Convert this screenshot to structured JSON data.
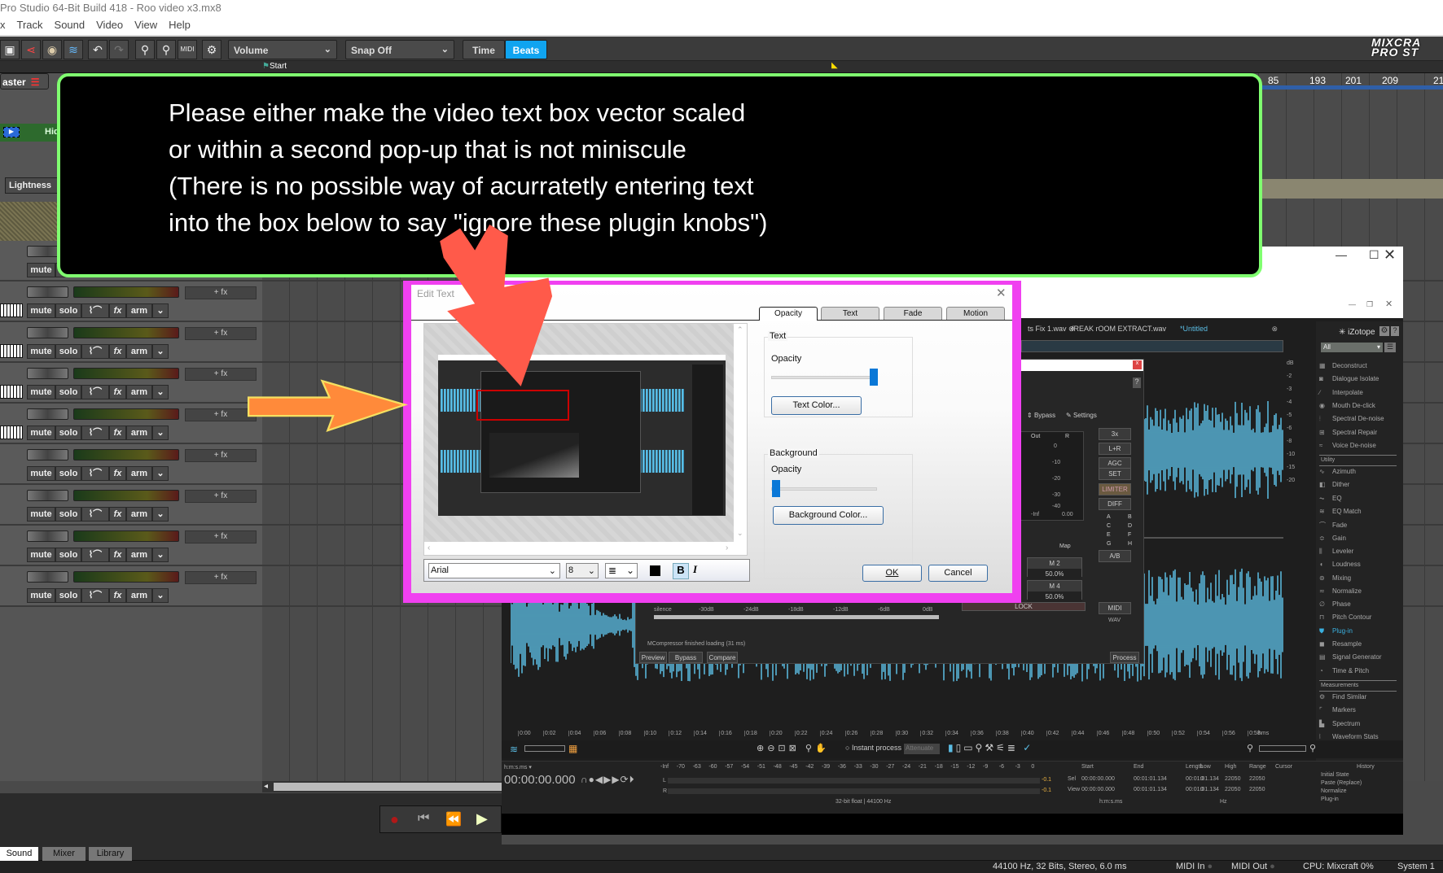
{
  "window": {
    "title": "Pro Studio 64-Bit Build 418 - Roo video x3.mx8"
  },
  "menu": [
    "x",
    "Track",
    "Sound",
    "Video",
    "View",
    "Help"
  ],
  "toolbar": {
    "icons": [
      "save-icon",
      "share-icon",
      "cd-burn-icon",
      "mixdown-icon",
      "undo-icon",
      "redo-icon",
      "zoom-in-icon",
      "zoom-out-icon",
      "midi-icon",
      "gear-icon"
    ],
    "automation_select": "Volume",
    "snap_select": "Snap Off",
    "time_label": "Time",
    "beats_label": "Beats",
    "logo_line1": "MIXCRA",
    "logo_line2": "PRO ST",
    "accent": "#10a4f0"
  },
  "timeline": {
    "start_marker": "Start",
    "bars": [
      "85",
      "193",
      "201",
      "209",
      "21"
    ]
  },
  "tracks": {
    "master": "aster",
    "video": "Hid",
    "lightness": "Lightness",
    "add_fx": "+ fx",
    "mute": "mute",
    "solo": "solo",
    "fx": "fx",
    "arm": "arm",
    "rows": [
      {
        "piano": false
      },
      {
        "piano": true
      },
      {
        "piano": true
      },
      {
        "piano": true
      },
      {
        "piano": true
      },
      {
        "piano": false
      },
      {
        "piano": false
      },
      {
        "piano": false
      },
      {
        "piano": false
      }
    ]
  },
  "annotation": {
    "lines": [
      "Please either make the video text box vector scaled",
      "or within a second pop-up that is not miniscule",
      "(There is no possible way of acurratetly entering text",
      "into the box below to say \"ignore these plugin knobs\")"
    ],
    "border_color": "#80ff70",
    "arrow_color": "#ff5a4a",
    "side_arrow_color": "#ff8a3a"
  },
  "edit_text": {
    "title": "Edit Text",
    "tabs": [
      "Opacity",
      "Text",
      "Fade",
      "Motion"
    ],
    "active_tab": "Opacity",
    "text_group": "Text",
    "opacity_label": "Opacity",
    "text_opacity": 100,
    "text_color_button": "Text Color...",
    "background_group": "Background",
    "background_opacity": 0,
    "background_color_button": "Background Color...",
    "font": "Arial",
    "size": "8",
    "bold": "B",
    "italic": "I",
    "ok": "OK",
    "cancel": "Cancel"
  },
  "izotope": {
    "file_tabs": [
      "ts Fix 1.wav",
      "fREAK rOOM EXTRACT.wav",
      "*Untitled"
    ],
    "brand": "iZotope",
    "filter": "All",
    "modules": [
      {
        "t": "item",
        "label": "Deconstruct"
      },
      {
        "t": "item",
        "label": "Dialogue Isolate"
      },
      {
        "t": "item",
        "label": "Interpolate"
      },
      {
        "t": "item",
        "label": "Mouth De-click"
      },
      {
        "t": "item",
        "label": "Spectral De-noise"
      },
      {
        "t": "item",
        "label": "Spectral Repair"
      },
      {
        "t": "item",
        "label": "Voice De-noise"
      },
      {
        "t": "head",
        "label": "Utility"
      },
      {
        "t": "item",
        "label": "Azimuth"
      },
      {
        "t": "item",
        "label": "Dither"
      },
      {
        "t": "item",
        "label": "EQ"
      },
      {
        "t": "item",
        "label": "EQ Match"
      },
      {
        "t": "item",
        "label": "Fade"
      },
      {
        "t": "item",
        "label": "Gain"
      },
      {
        "t": "item",
        "label": "Leveler"
      },
      {
        "t": "item",
        "label": "Loudness"
      },
      {
        "t": "item",
        "label": "Mixing"
      },
      {
        "t": "item",
        "label": "Normalize"
      },
      {
        "t": "item",
        "label": "Phase"
      },
      {
        "t": "item",
        "label": "Pitch Contour"
      },
      {
        "t": "item",
        "label": "Plug-in",
        "active": true
      },
      {
        "t": "item",
        "label": "Resample"
      },
      {
        "t": "item",
        "label": "Signal Generator"
      },
      {
        "t": "item",
        "label": "Time & Pitch"
      },
      {
        "t": "head",
        "label": "Measurements"
      },
      {
        "t": "item",
        "label": "Find Similar"
      },
      {
        "t": "item",
        "label": "Markers"
      },
      {
        "t": "item",
        "label": "Spectrum"
      },
      {
        "t": "item",
        "label": "Waveform Stats"
      }
    ],
    "db_scale": [
      "dB",
      "-2",
      "-3",
      "-4",
      "-5",
      "-6",
      "-8",
      "-10",
      "-15",
      "-20"
    ],
    "time_ruler": [
      "0:00",
      "0:02",
      "0:04",
      "0:06",
      "0:08",
      "0:10",
      "0:12",
      "0:14",
      "0:16",
      "0:18",
      "0:20",
      "0:22",
      "0:24",
      "0:26",
      "0:28",
      "0:30",
      "0:32",
      "0:34",
      "0:36",
      "0:38",
      "0:40",
      "0:42",
      "0:44",
      "0:46",
      "0:48",
      "0:50",
      "0:52",
      "0:54",
      "0:56",
      "0:58"
    ],
    "time_unit": "hms",
    "instant_process": "Instant process",
    "instant_mode": "Attenuate",
    "time_format": "h:m:s.ms ▾",
    "time": "00:00:00.000",
    "meter_scale": [
      "-Inf",
      "-70",
      "-63",
      "-60",
      "-57",
      "-54",
      "-51",
      "-48",
      "-45",
      "-42",
      "-39",
      "-36",
      "-33",
      "-30",
      "-27",
      "-24",
      "-21",
      "-18",
      "-15",
      "-12",
      "-9",
      "-6",
      "-3",
      "0"
    ],
    "meter_L": "L",
    "meter_R": "R",
    "peak_L": "-0.1",
    "peak_R": "-0.1",
    "format": "32-bit float | 44100 Hz",
    "sel_headers": [
      "Start",
      "End",
      "Length"
    ],
    "sel_rows": [
      {
        "label": "Sel",
        "values": [
          "00:00:00.000",
          "00:01:01.134",
          "00:01:01.134"
        ]
      },
      {
        "label": "View",
        "values": [
          "00:00:00.000",
          "00:01:01.134",
          "00:01:01.134"
        ]
      }
    ],
    "sel_unit": "h:m:s.ms",
    "freq_headers": [
      "Low",
      "High",
      "Range"
    ],
    "freq_rows": [
      [
        "0",
        "22050",
        "22050"
      ],
      [
        "0",
        "22050",
        "22050"
      ]
    ],
    "freq_unit": "Hz",
    "cursor": "Cursor",
    "history_title": "History",
    "history": [
      "Initial State",
      "Paste (Replace)",
      "Normalize",
      "Plug-in"
    ],
    "waveform_color": "#5bbde4"
  },
  "plugin": {
    "bypass": "Bypass",
    "settings": "Settings",
    "help": "?",
    "out": "Out",
    "r": "R",
    "scale": [
      "0",
      "-10",
      "-20",
      "-30",
      "-40"
    ],
    "inf": "-Inf",
    "peak": "0.00",
    "side": [
      "3x",
      "L+R",
      "AGC",
      "SET",
      "LIMITER",
      "DIFF"
    ],
    "presets": [
      "A",
      "B",
      "C",
      "D",
      "E",
      "F",
      "G",
      "H"
    ],
    "ab": "A/B",
    "midi": "MIDI",
    "wav": "WAV",
    "map": "Map",
    "m2": "M 2",
    "m2v": "50.0%",
    "m4": "M 4",
    "m4v": "50.0%",
    "lock": "LOCK",
    "thresh": [
      "silence",
      "-30dB",
      "-24dB",
      "-18dB",
      "-12dB",
      "-6dB",
      "0dB"
    ],
    "status": "MCompressor finished loading (31 ms)",
    "preview": "Preview",
    "bypass_btn": "Bypass",
    "compare": "Compare",
    "process": "Process"
  },
  "bottom_tabs": [
    "Sound",
    "Mixer",
    "Library"
  ],
  "status": {
    "audio": "44100 Hz, 32 Bits, Stereo, 6.0 ms",
    "midi_in": "MIDI In",
    "midi_out": "MIDI Out",
    "cpu": "CPU: Mixcraft 0%",
    "system": "System 1"
  }
}
